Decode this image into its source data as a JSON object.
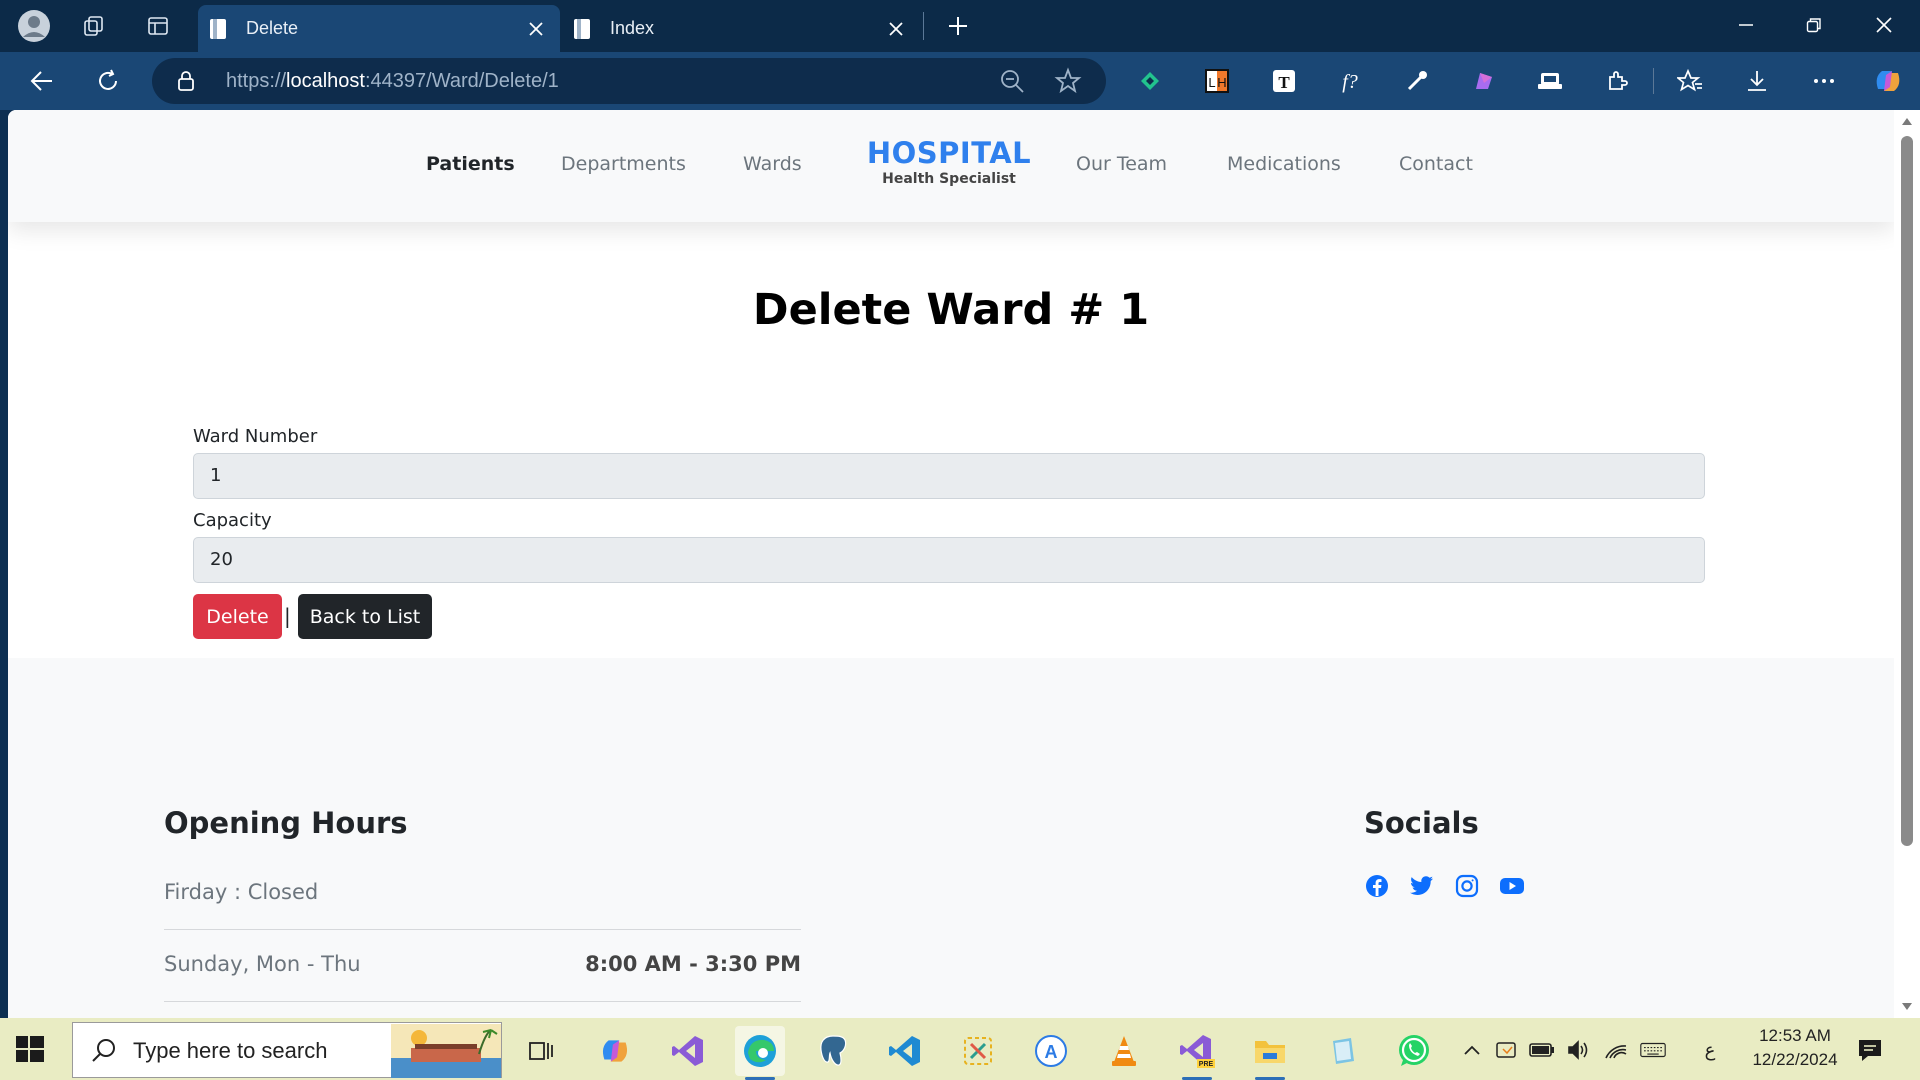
{
  "browser": {
    "tabs": [
      {
        "title": "Delete",
        "active": true
      },
      {
        "title": "Index",
        "active": false
      }
    ],
    "url_prefix": "https://",
    "url_host": "localhost",
    "url_rest": ":44397/Ward/Delete/1"
  },
  "site": {
    "nav_left": [
      "Patients",
      "Departments",
      "Wards"
    ],
    "brand_title": "HOSPITAL",
    "brand_subtitle": "Health Specialist",
    "nav_right": [
      "Our Team",
      "Medications",
      "Contact"
    ]
  },
  "page": {
    "title": "Delete Ward # 1",
    "fields": [
      {
        "label": "Ward Number",
        "value": "1"
      },
      {
        "label": "Capacity",
        "value": "20"
      }
    ],
    "delete_label": "Delete",
    "separator": "|",
    "back_label": "Back to List"
  },
  "footer": {
    "hours_title": "Opening Hours",
    "hours": [
      {
        "day": "Firday : Closed",
        "time": ""
      },
      {
        "day": "Sunday, Mon - Thu",
        "time": "8:00 AM - 3:30 PM"
      }
    ],
    "socials_title": "Socials",
    "socials": [
      "facebook-icon",
      "twitter-icon",
      "instagram-icon",
      "youtube-icon"
    ],
    "social_color": "#0d6efd"
  },
  "taskbar": {
    "search_placeholder": "Type here to search",
    "time": "12:53 AM",
    "date": "12/22/2024",
    "ime": "ع"
  },
  "colors": {
    "brand": "#2f80ed",
    "danger": "#dc3545",
    "dark": "#212529",
    "chrome_dark": "#0c2a48",
    "chrome_light": "#1a4775"
  }
}
